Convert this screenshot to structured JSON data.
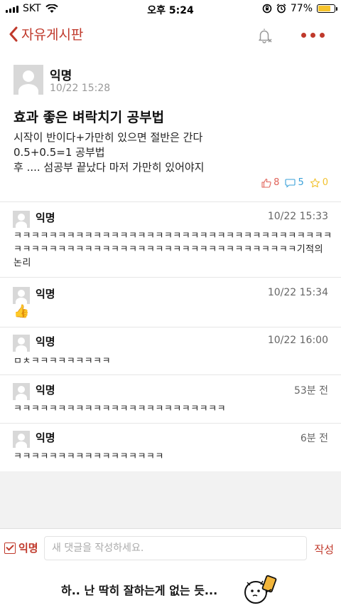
{
  "status": {
    "carrier": "SKT",
    "time": "오후 5:24",
    "battery": "77%",
    "battery_level": 0.77
  },
  "nav": {
    "back_label": "자유게시판"
  },
  "post": {
    "author": "익명",
    "time": "10/22 15:28",
    "title": "효과 좋은 벼락치기 공부법",
    "body": [
      "시작이 반이다+가만히 있으면 절반은 간다",
      "0.5+0.5=1 공부법",
      "후 .... 섬공부 끝났다 마저 가만히 있어야지"
    ],
    "likes": "8",
    "comments": "5",
    "scraps": "0",
    "colors": {
      "like": "#e0635a",
      "comment": "#3aa0d8",
      "scrap": "#f2c230"
    }
  },
  "comments": [
    {
      "author": "익명",
      "time": "10/22 15:33",
      "text": "ㅋㅋㅋㅋㅋㅋㅋㅋㅋㅋㅋㅋㅋㅋㅋㅋㅋㅋㅋㅋㅋㅋㅋㅋㅋㅋㅋㅋㅋㅋㅋㅋㅋㅋㅋㅋㅋㅋㅋㅋㅋㅋㅋㅋㅋㅋㅋㅋㅋㅋㅋㅋㅋㅋㅋㅋㅋㅋㅋㅋㅋㅋㅋㅋㅋㅋㅋㅋ기적의 논리"
    },
    {
      "author": "익명",
      "time": "10/22 15:34",
      "text": "👍"
    },
    {
      "author": "익명",
      "time": "10/22 16:00",
      "text": "ㅁㅊㅋㅋㅋㅋㅋㅋㅋㅋㅋ"
    },
    {
      "author": "익명",
      "time": "53분 전",
      "text": "ㅋㅋㅋㅋㅋㅋㅋㅋㅋㅋㅋㅋㅋㅋㅋㅋㅋㅋㅋㅋㅋㅋㅋㅋ"
    },
    {
      "author": "익명",
      "time": "6분 전",
      "text": "ㅋㅋㅋㅋㅋㅋㅋㅋㅋㅋㅋㅋㅋㅋㅋㅋㅋ"
    }
  ],
  "composer": {
    "anon_label": "익명",
    "placeholder": "새 댓글을 작성하세요.",
    "submit_label": "작성"
  },
  "banner": {
    "text": "하.. 난 딱히 잘하는게 없는 듯..."
  },
  "colors": {
    "accent": "#c0392b",
    "battery": "#f6c32b"
  }
}
